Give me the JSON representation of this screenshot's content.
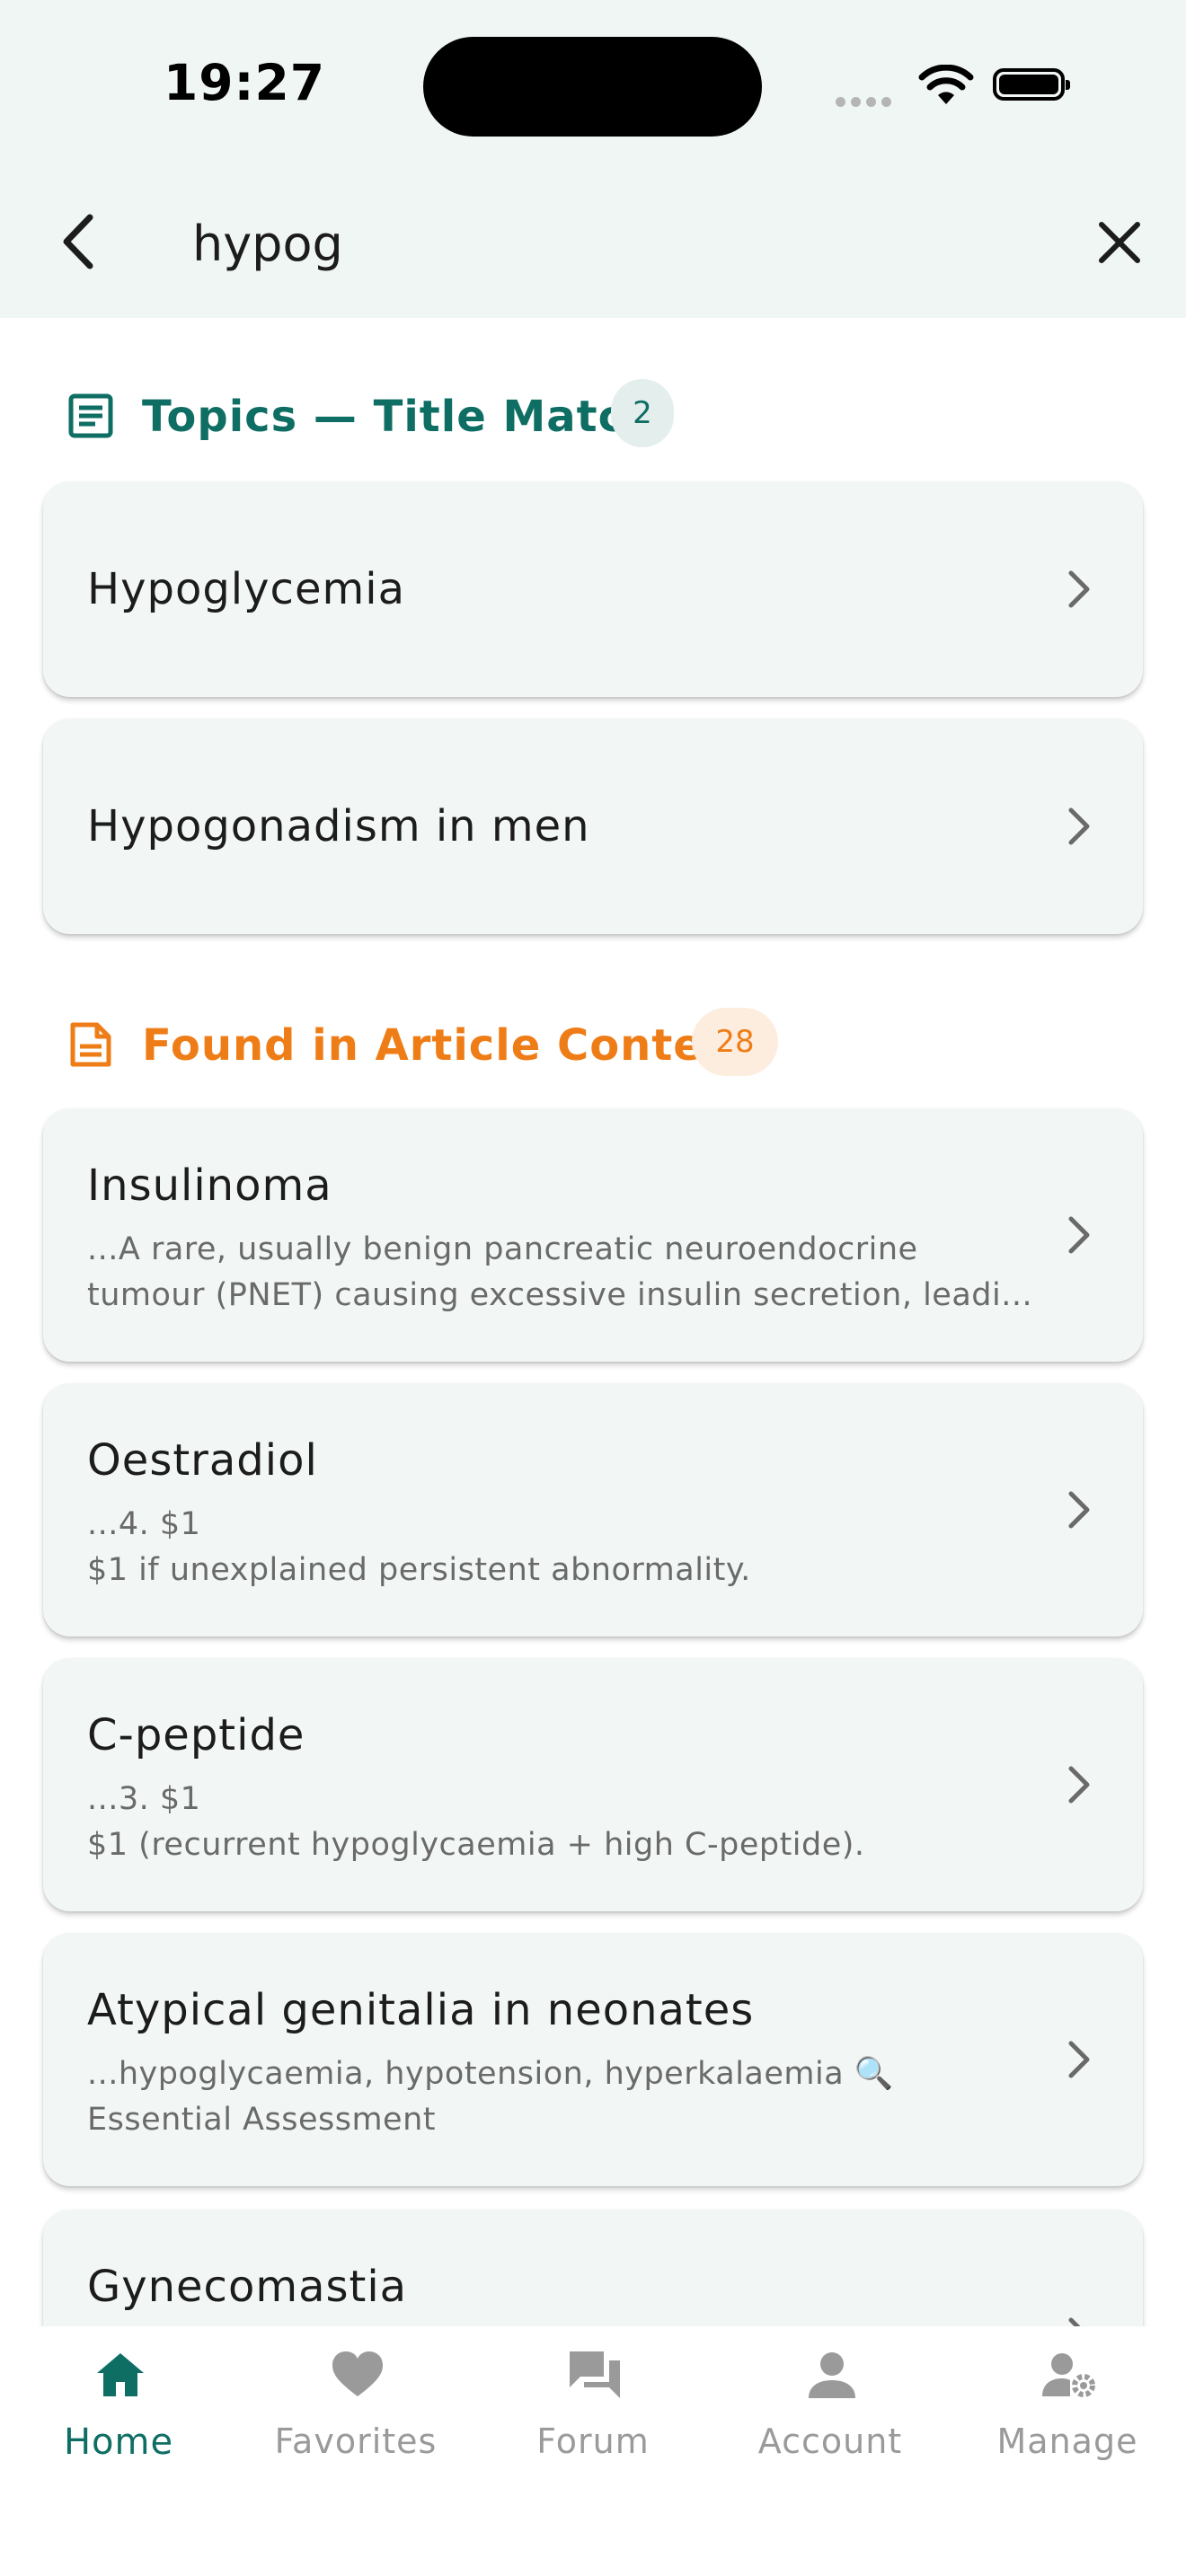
{
  "status_bar": {
    "time": "19:27"
  },
  "search": {
    "query": "hypog",
    "back_icon": "chevron-left-icon",
    "clear_icon": "close-icon"
  },
  "colors": {
    "accent": "#0f6e64",
    "content_accent": "#ef7d17",
    "card_bg": "#f2f7f5",
    "header_bg": "#f0f6f4"
  },
  "title_section": {
    "label": "Topics — Title Match",
    "count": "2",
    "icon": "article-icon",
    "results": [
      {
        "title": "Hypoglycemia"
      },
      {
        "title": "Hypogonadism in men"
      }
    ]
  },
  "content_section": {
    "label": "Found in Article Content",
    "count": "28",
    "icon": "document-icon",
    "results": [
      {
        "title": "Insulinoma",
        "snippet_1": "...A rare, usually benign pancreatic neuroendocrine",
        "snippet_2": "tumour (PNET) causing excessive insulin secretion, leadi..."
      },
      {
        "title": "Oestradiol",
        "snippet_1": "...4. $1",
        "snippet_2": "$1 if unexplained persistent abnormality."
      },
      {
        "title": "C-peptide",
        "snippet_1": "...3. $1",
        "snippet_2": "$1 (recurrent hypoglycaemia + high C-peptide)."
      },
      {
        "title": "Atypical genitalia in neonates",
        "snippet_1": "...hypoglycaemia, hypotension, hyperkalaemia 🔍",
        "snippet_2": "Essential Assessment"
      },
      {
        "title": "Gynecomastia"
      }
    ]
  },
  "bottom_nav": {
    "items": [
      {
        "label": "Home",
        "icon": "home-icon",
        "active": true
      },
      {
        "label": "Favorites",
        "icon": "heart-icon"
      },
      {
        "label": "Forum",
        "icon": "forum-icon"
      },
      {
        "label": "Account",
        "icon": "person-icon"
      },
      {
        "label": "Manage",
        "icon": "manage-accounts-icon"
      }
    ]
  }
}
